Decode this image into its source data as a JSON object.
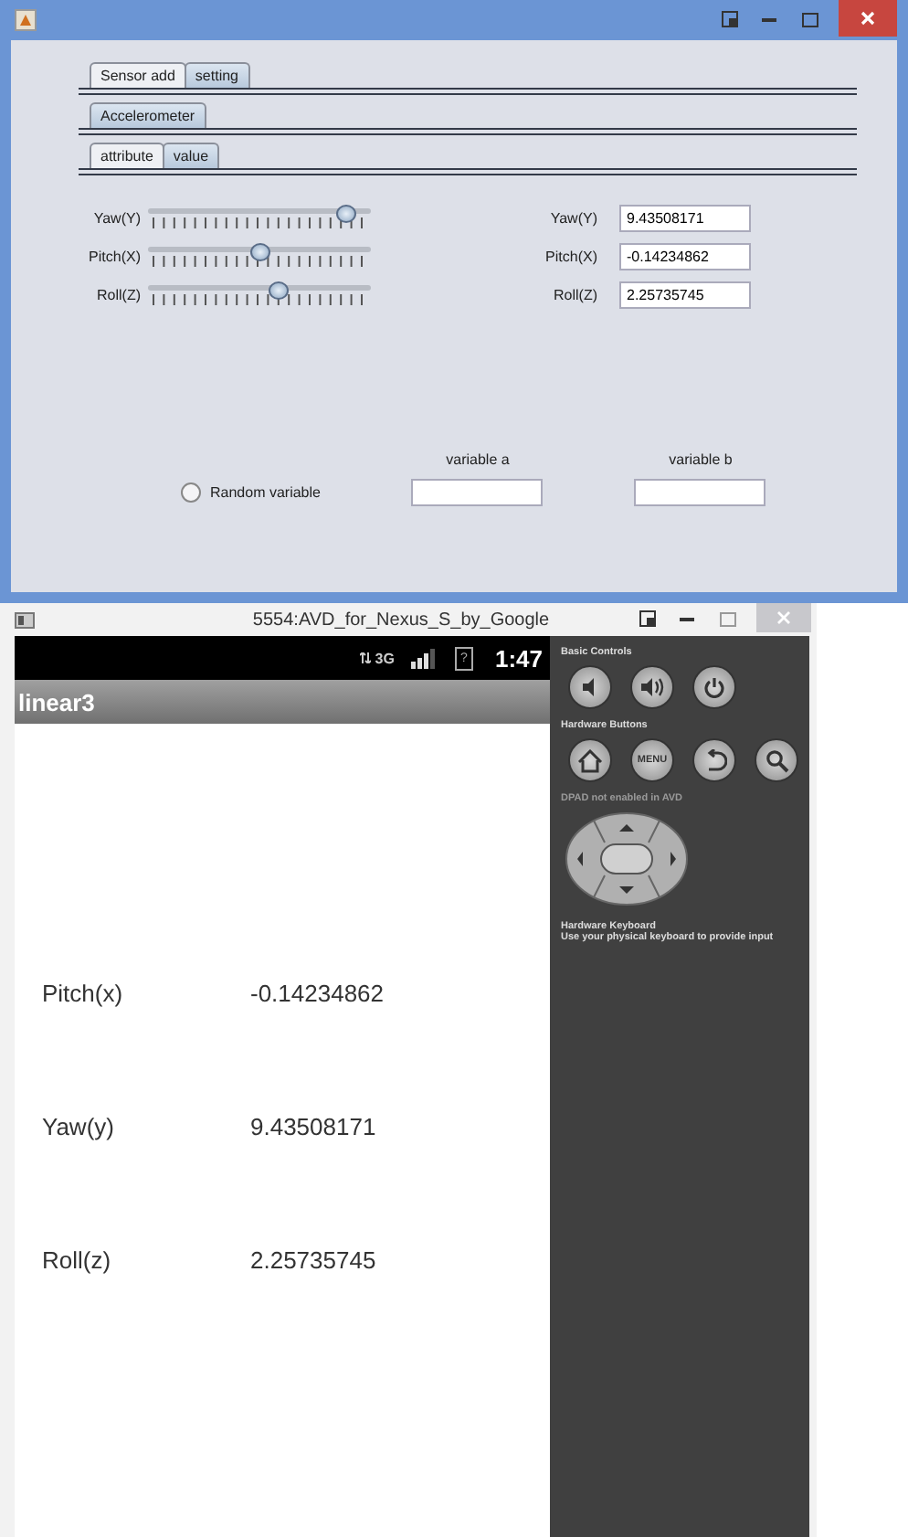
{
  "java_window": {
    "tabs": [
      {
        "label": "Sensor add",
        "selected": false
      },
      {
        "label": "setting",
        "selected": true
      }
    ],
    "sensor_tabs": [
      {
        "label": "Accelerometer",
        "selected": true
      }
    ],
    "view_tabs": [
      {
        "label": "attribute",
        "selected": false
      },
      {
        "label": "value",
        "selected": true
      }
    ],
    "sliders": [
      {
        "label": "Yaw(Y)",
        "level": 0.92
      },
      {
        "label": "Pitch(X)",
        "level": 0.5
      },
      {
        "label": "Roll(Z)",
        "level": 0.59
      }
    ],
    "fields": [
      {
        "label": "Yaw(Y)",
        "value": "9.43508171"
      },
      {
        "label": "Pitch(X)",
        "value": "-0.14234862"
      },
      {
        "label": "Roll(Z)",
        "value": "2.25735745"
      }
    ],
    "random_variable": {
      "label": "Random variable",
      "selected": false
    },
    "variables": [
      {
        "label": "variable a"
      },
      {
        "label": "variable b"
      }
    ]
  },
  "emulator": {
    "title": "5554:AVD_for_Nexus_S_by_Google",
    "network": "3G",
    "battery": "?",
    "time": "1:47",
    "app_title": "linear3",
    "rows": [
      {
        "label": "Pitch(x)",
        "value": "-0.14234862"
      },
      {
        "label": "Yaw(y)",
        "value": "9.43508171"
      },
      {
        "label": "Roll(z)",
        "value": "2.25735745"
      }
    ],
    "controls": {
      "basic_title": "Basic Controls",
      "hardware_title": "Hardware Buttons",
      "menu_label": "MENU",
      "dpad_note": "**DPAD** not enabled in AVD",
      "keyboard_title": "Hardware Keyboard",
      "keyboard_note": "Use your physical keyboard to provide input"
    }
  }
}
